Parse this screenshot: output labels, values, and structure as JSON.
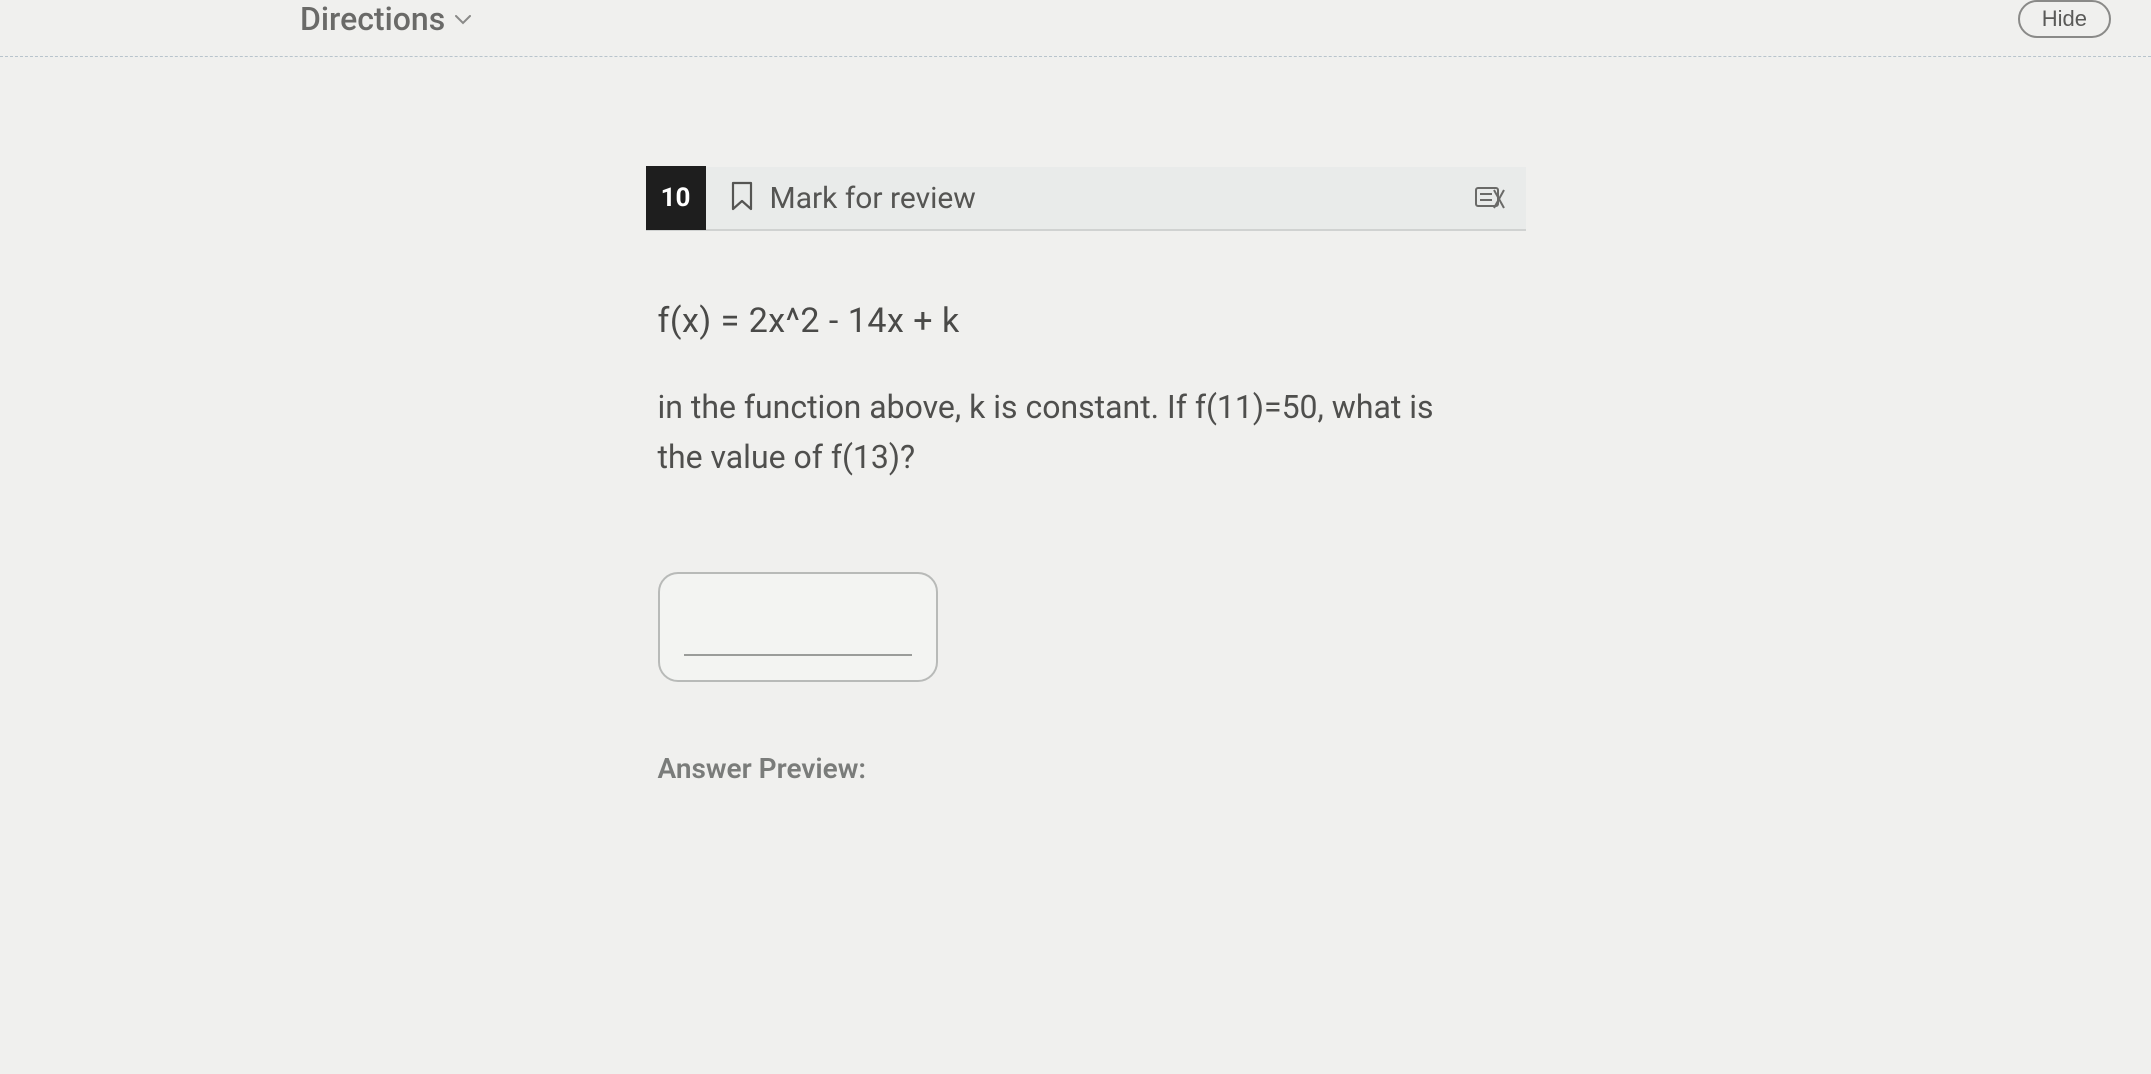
{
  "topbar": {
    "directions_label": "Directions",
    "hide_label": "Hide"
  },
  "question": {
    "number": "10",
    "mark_for_review_label": "Mark for review",
    "formula": "f(x) = 2x^2 - 14x + k",
    "prompt": "in the function above, k is constant. If f(11)=50, what is the value of f(13)?",
    "answer_value": "",
    "answer_preview_label": "Answer Preview:"
  }
}
